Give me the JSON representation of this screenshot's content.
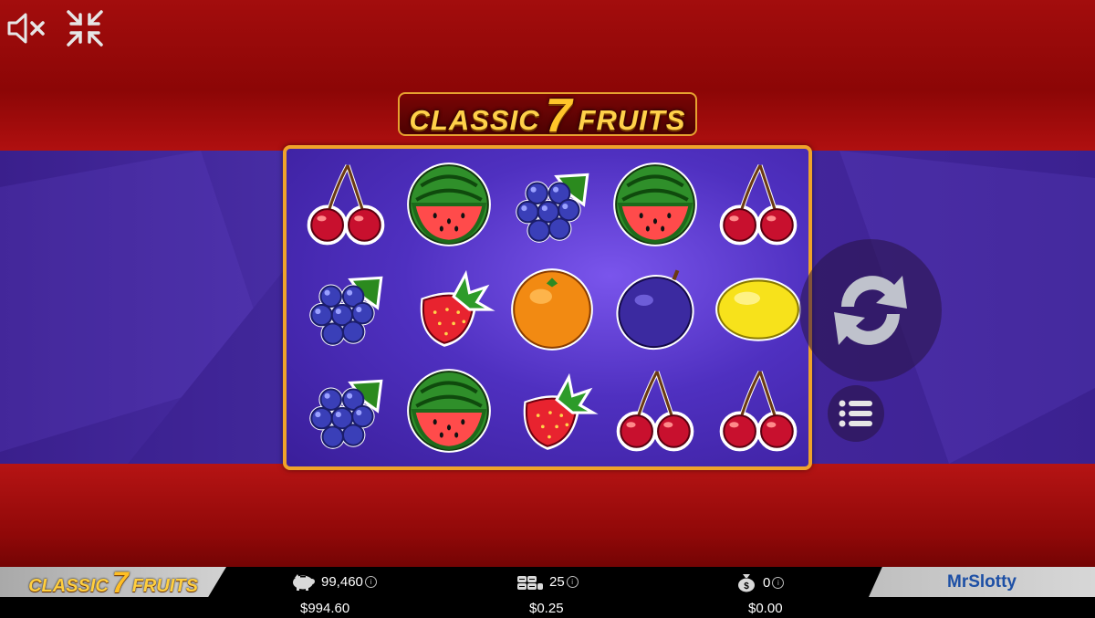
{
  "game": {
    "title_left": "CLASSIC",
    "title_seven": "7",
    "title_right": "FRUITS"
  },
  "controls": {
    "sound_icon": "speaker-muted-icon",
    "fullscreen_icon": "exit-fullscreen-icon",
    "spin_icon": "spin-arrows-icon",
    "menu_icon": "menu-list-icon"
  },
  "reels": [
    [
      "cherry",
      "watermelon",
      "grapes",
      "watermelon",
      "cherry"
    ],
    [
      "grapes",
      "strawberry",
      "orange",
      "plum",
      "lemon"
    ],
    [
      "grapes",
      "watermelon",
      "strawberry",
      "cherry",
      "cherry"
    ]
  ],
  "bottom_bar": {
    "brand": "MrSlotty",
    "balance_credits": "99,460",
    "balance_money": "$994.60",
    "bet_credits": "25",
    "bet_money": "$0.25",
    "win_credits": "0",
    "win_money": "$0.00"
  },
  "colors": {
    "frame": "#f0a32a",
    "red_bg": "#a30d0d",
    "purple_bg": "#4a2fa8"
  }
}
